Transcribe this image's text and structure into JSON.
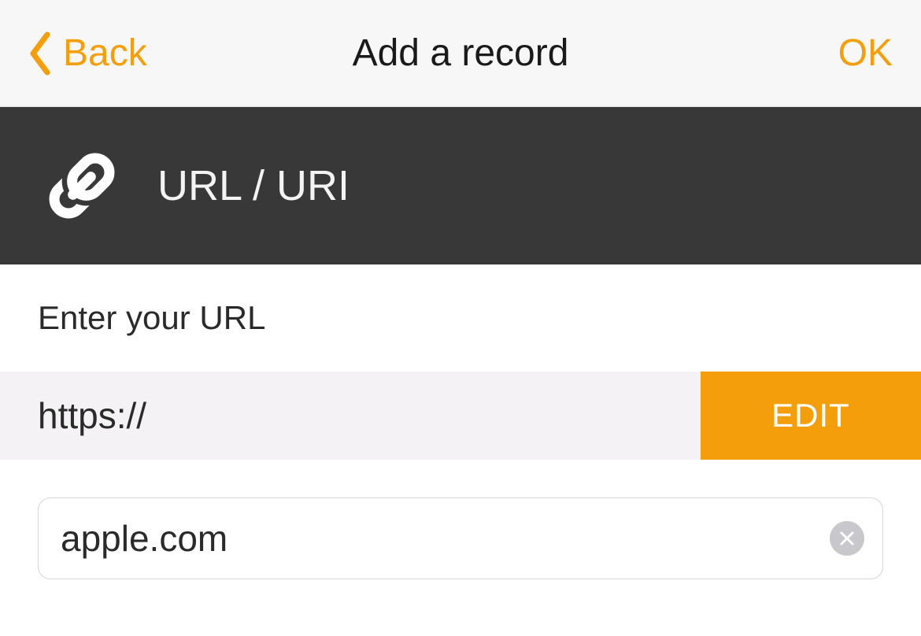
{
  "nav": {
    "back": "Back",
    "title": "Add a record",
    "ok": "OK"
  },
  "section": {
    "title": "URL / URI"
  },
  "form": {
    "prompt": "Enter your URL",
    "protocol": "https://",
    "edit": "EDIT",
    "value": "apple.com"
  }
}
